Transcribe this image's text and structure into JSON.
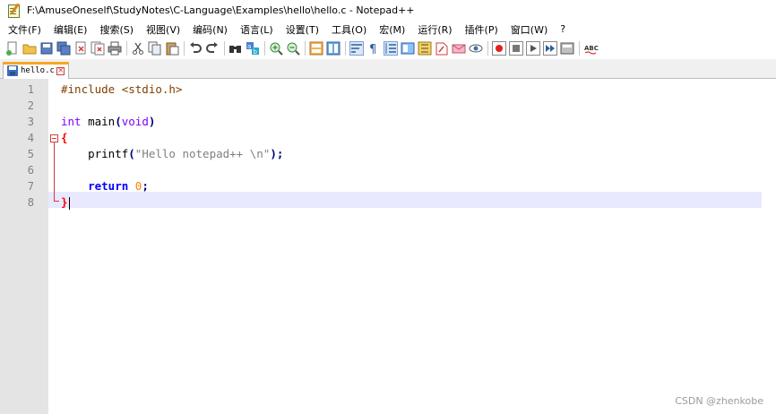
{
  "window": {
    "title": "F:\\AmuseOneself\\StudyNotes\\C-Language\\Examples\\hello\\hello.c - Notepad++"
  },
  "menu": [
    "文件(F)",
    "编辑(E)",
    "搜索(S)",
    "视图(V)",
    "编码(N)",
    "语言(L)",
    "设置(T)",
    "工具(O)",
    "宏(M)",
    "运行(R)",
    "插件(P)",
    "窗口(W)",
    "?"
  ],
  "toolbar": {
    "buttons": [
      "new-file-icon",
      "open-file-icon",
      "save-icon",
      "save-all-icon",
      "close-icon",
      "close-all-icon",
      "print-icon",
      "cut-icon",
      "copy-icon",
      "paste-icon",
      "undo-icon",
      "redo-icon",
      "find-icon",
      "replace-icon",
      "zoom-in-icon",
      "zoom-out-icon",
      "sync-vertical-icon",
      "sync-horizontal-icon",
      "word-wrap-icon",
      "show-all-chars-icon",
      "indent-guide-icon",
      "doc-map-icon",
      "function-list-icon",
      "folder-workspace-icon",
      "monitoring-icon",
      "record-macro-icon",
      "stop-macro-icon",
      "play-macro-icon",
      "run-macro-multiple-icon",
      "save-macro-icon",
      "spell-check-icon"
    ],
    "spell_label": "ABC"
  },
  "tab": {
    "label": "hello.c"
  },
  "editor": {
    "line_numbers": [
      "1",
      "2",
      "3",
      "4",
      "5",
      "6",
      "7",
      "8"
    ],
    "lines": {
      "l1": {
        "pre": "#include <stdio.h>"
      },
      "l3": {
        "type": "int",
        "rest": " main",
        "paren_open": "(",
        "param": "void",
        "paren_close": ")"
      },
      "l4": {
        "brace": "{"
      },
      "l5": {
        "indent": "    ",
        "func": "printf",
        "paren_open": "(",
        "str": "\"Hello notepad++ \\n\"",
        "paren_close": ")",
        "semi": ";"
      },
      "l7": {
        "indent": "    ",
        "kw": "return",
        "space": " ",
        "num": "0",
        "semi": ";"
      },
      "l8": {
        "brace": "}"
      }
    },
    "current_line": 8
  },
  "watermark": "CSDN @zhenkobe",
  "colors": {
    "gutter": "#e4e4e4",
    "current_line": "#e8e8ff",
    "fold_marker": "#d23c3c",
    "keyword_blue": "#0000ff",
    "type_purple": "#8000ff",
    "preprocessor": "#804000",
    "number_orange": "#ff8000",
    "tab_accent": "#f6a623"
  }
}
